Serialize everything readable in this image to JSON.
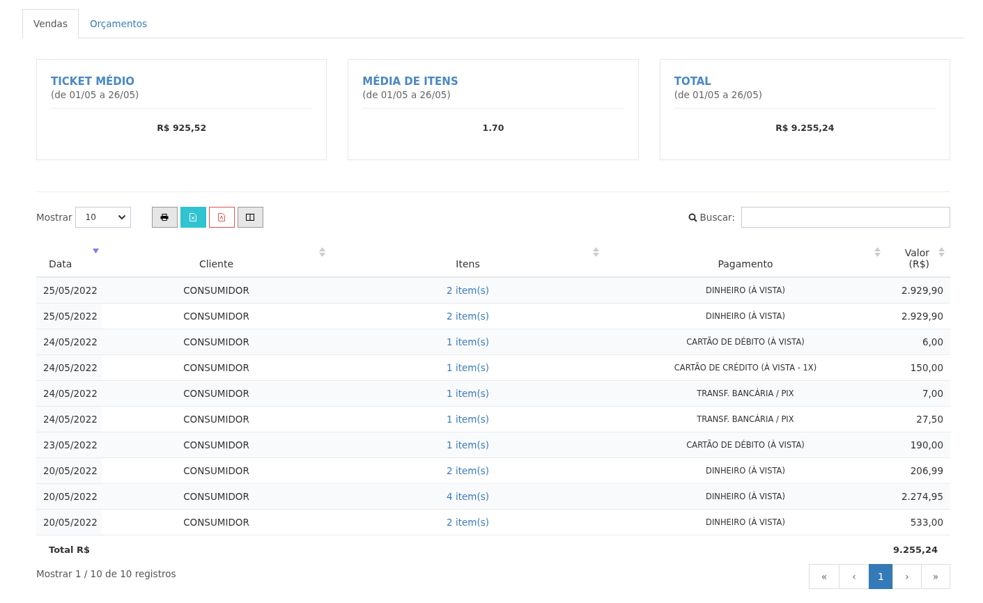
{
  "tabs": [
    {
      "label": "Vendas",
      "selected": true
    },
    {
      "label": "Orçamentos",
      "selected": false
    }
  ],
  "cards": [
    {
      "title": "TICKET MÉDIO",
      "period": "(de 01/05 a 26/05)",
      "value": "R$ 925,52"
    },
    {
      "title": "MÉDIA DE ITENS",
      "period": "(de 01/05 a 26/05)",
      "value": "1.70"
    },
    {
      "title": "TOTAL",
      "period": "(de 01/05 a 26/05)",
      "value": "R$ 9.255,24"
    }
  ],
  "length_label": "Mostrar",
  "length_value": "10",
  "export_buttons": [
    {
      "kind": "print"
    },
    {
      "kind": "excel"
    },
    {
      "kind": "pdf"
    },
    {
      "kind": "columns"
    }
  ],
  "search": {
    "label": "Buscar:"
  },
  "table": {
    "columns": [
      {
        "label": "Data",
        "sorted": true
      },
      {
        "label": "Cliente",
        "sorted": false
      },
      {
        "label": "Itens",
        "sorted": false
      },
      {
        "label": "Pagamento",
        "sorted": false
      },
      {
        "label": "Valor (R$)",
        "sorted": false
      }
    ],
    "rows": [
      [
        "25/05/2022",
        "CONSUMIDOR",
        "2 item(s)",
        "DINHEIRO (À VISTA)",
        "2.929,90"
      ],
      [
        "25/05/2022",
        "CONSUMIDOR",
        "2 item(s)",
        "DINHEIRO (À VISTA)",
        "2.929,90"
      ],
      [
        "24/05/2022",
        "CONSUMIDOR",
        "1 item(s)",
        "CARTÃO DE DÉBITO (À VISTA)",
        "6,00"
      ],
      [
        "24/05/2022",
        "CONSUMIDOR",
        "1 item(s)",
        "CARTÃO DE CRÉDITO (À VISTA - 1X)",
        "150,00"
      ],
      [
        "24/05/2022",
        "CONSUMIDOR",
        "1 item(s)",
        "TRANSF. BANCÁRIA / PIX",
        "7,00"
      ],
      [
        "24/05/2022",
        "CONSUMIDOR",
        "1 item(s)",
        "TRANSF. BANCÁRIA / PIX",
        "27,50"
      ],
      [
        "23/05/2022",
        "CONSUMIDOR",
        "1 item(s)",
        "CARTÃO DE DÉBITO (À VISTA)",
        "190,00"
      ],
      [
        "20/05/2022",
        "CONSUMIDOR",
        "2 item(s)",
        "DINHEIRO (À VISTA)",
        "206,99"
      ],
      [
        "20/05/2022",
        "CONSUMIDOR",
        "4 item(s)",
        "DINHEIRO (À VISTA)",
        "2.274,95"
      ],
      [
        "20/05/2022",
        "CONSUMIDOR",
        "2 item(s)",
        "DINHEIRO (À VISTA)",
        "533,00"
      ]
    ],
    "footer": {
      "label": "Total R$",
      "value": "9.255,24"
    }
  },
  "info": "Mostrar 1 / 10 de 10 registros",
  "pagination": [
    {
      "label": "«",
      "selected": false
    },
    {
      "label": "‹",
      "selected": false
    },
    {
      "label": "1",
      "selected": true
    },
    {
      "label": "›",
      "selected": false
    },
    {
      "label": "»",
      "selected": false
    }
  ]
}
